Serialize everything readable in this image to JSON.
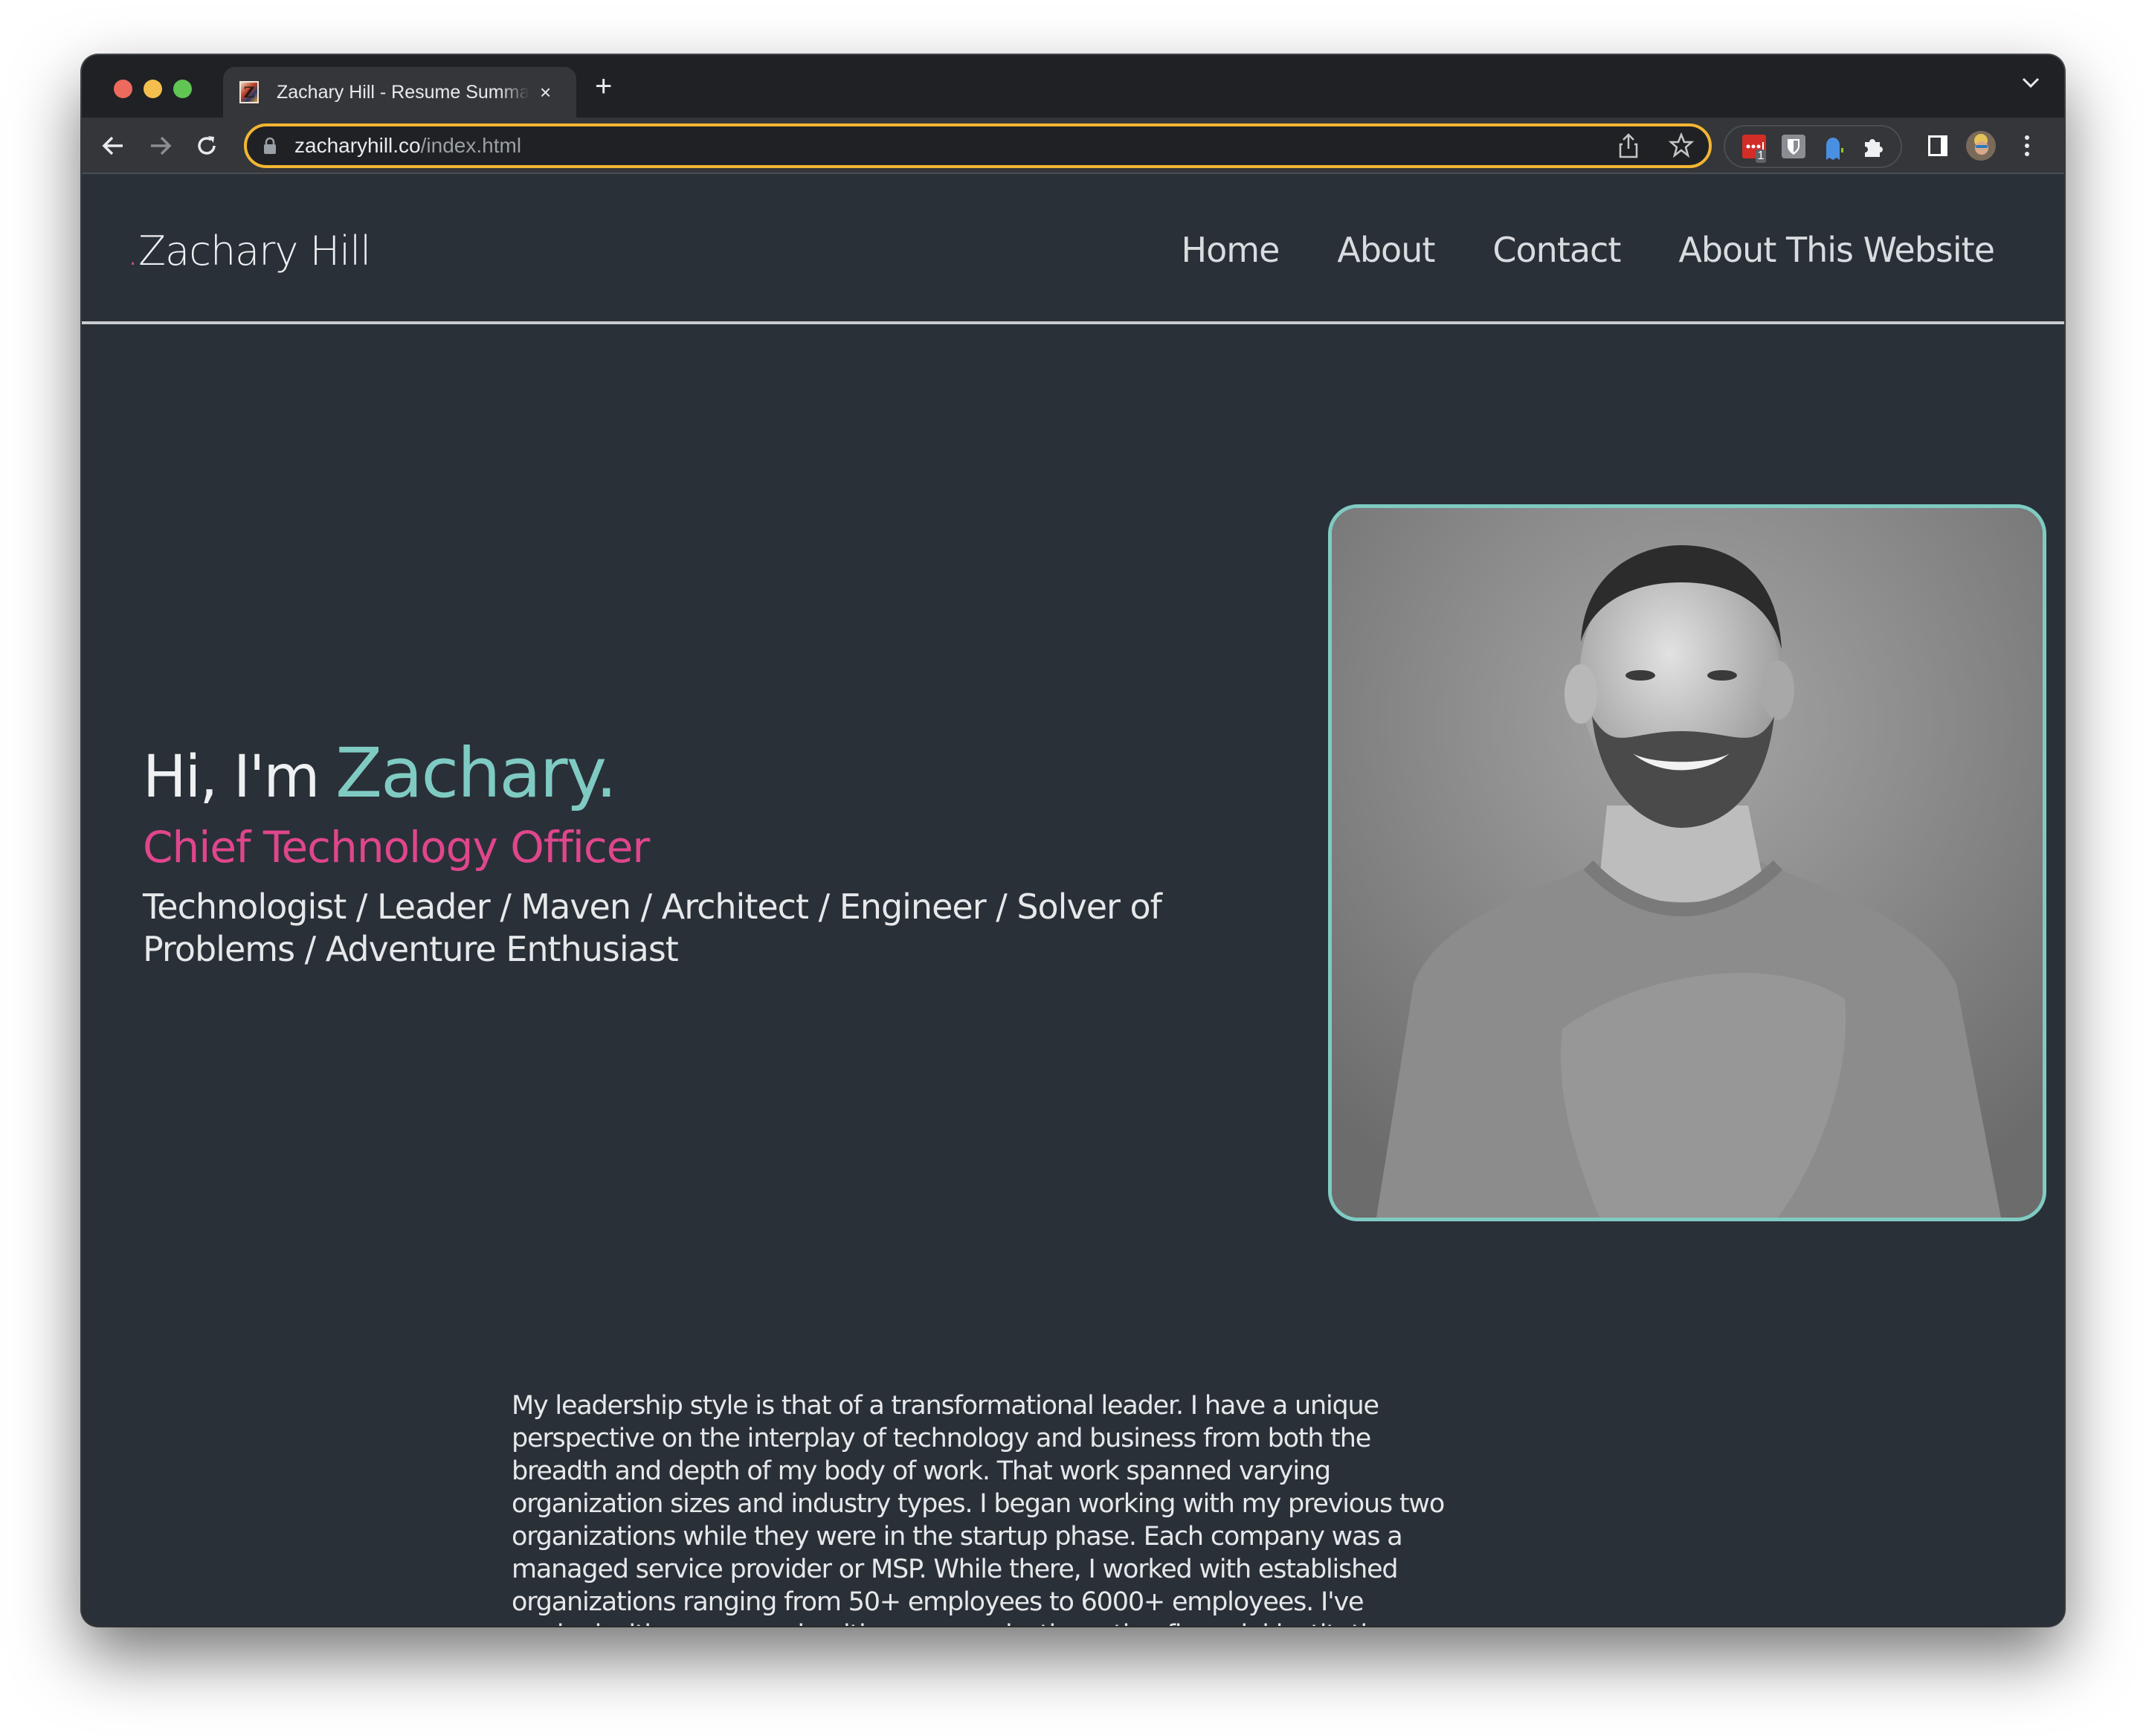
{
  "browser": {
    "tab": {
      "title": "Zachary Hill - Resume Summary",
      "favicon_glyph": "Z",
      "close_glyph": "×"
    },
    "new_tab_glyph": "+",
    "url": {
      "host": "zacharyhill.co",
      "path": "/index.html"
    },
    "extensions": [
      {
        "name": "lastpass",
        "badge": "1",
        "color": "#d32d27"
      },
      {
        "name": "bitwarden",
        "color": "#8a8d91"
      },
      {
        "name": "ghostery",
        "color": "#4a90e2"
      },
      {
        "name": "extensions-puzzle",
        "color": "#eef0f2"
      }
    ]
  },
  "site": {
    "logo": {
      "dot": ".",
      "name": "Zachary Hill"
    },
    "nav": [
      {
        "label": "Home"
      },
      {
        "label": "About"
      },
      {
        "label": "Contact"
      },
      {
        "label": "About This Website"
      }
    ],
    "hero": {
      "greeting": "Hi, I'm ",
      "name": "Zachary.",
      "role": "Chief Technology Officer",
      "tagline": "Technologist / Leader / Maven / Architect / Engineer / Solver of Problems / Adventure Enthusiast",
      "photo_alt": "Black and white portrait of Zachary smiling in a t-shirt"
    },
    "bio": "My leadership style is that of a transformational leader. I have a unique perspective on the interplay of technology and business from both the breadth and depth of my body of work. That work spanned varying organization sizes and industry types. I began working with my previous two organizations while they were in the startup phase. Each company was a managed service provider or MSP. While there, I worked with established organizations ranging from 50+ employees to 6000+ employees. I've worked with enormous healthcare organizations, tiny financial institutions, technology firms, hospitality organizations, construction, and enormous"
  },
  "colors": {
    "page_bg": "#2a3038",
    "accent_teal": "#7fcbc3",
    "accent_pink": "#e0468c",
    "omnibox_focus": "#f2b632"
  }
}
